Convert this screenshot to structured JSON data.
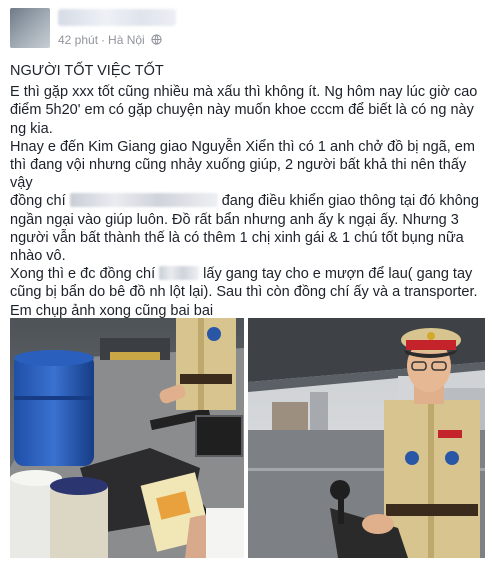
{
  "post": {
    "time": "42 phút",
    "separator": "·",
    "location": "Hà Nội",
    "title": "NGƯỜI TỐT VIỆC TỐT",
    "lines": [
      "E thì gặp xxx tốt cũng nhiều mà xấu thì không ít. Ng hôm nay lúc giờ cao",
      "điểm 5h20' em có gặp chuyện này muốn khoe cccm để biết là có ng này",
      "ng kia.",
      "Hnay e đến Kim Giang giao Nguyễn Xiển thì có 1 anh chở đồ bị ngã, em",
      "thì đang vội nhưng cũng nhảy xuống giúp, 2 người bất khả thi nên thấy vậy"
    ],
    "line6_before": "đồng chí",
    "line6_after": "đang điều khiển giao thông tại đó không",
    "lines_mid": [
      "ngần ngại vào giúp luôn. Đồ rất bẩn nhưng anh ấy k ngại ấy. Nhưng 3",
      "người vẫn bất thành thế là có thêm 1 chị xinh gái & 1 chú tốt bụng nữa",
      "nhào vô."
    ],
    "line10_before": "Xong thì e đc đồng chí",
    "line10_after": "lấy gang tay cho e mượn để lau( gang tay",
    "lines_end": [
      "cũng bị bẩn do bê đồ nh lột lại). Sau thì còn đồng chí ấy và a transporter.",
      "Em chụp ảnh xong cũng bai bai"
    ]
  },
  "icons": {
    "globe": "globe-icon"
  },
  "colors": {
    "meta": "#90949c",
    "text": "#1d2129",
    "police_uniform": "#d8c48e",
    "police_cap_band": "#c4232b"
  }
}
